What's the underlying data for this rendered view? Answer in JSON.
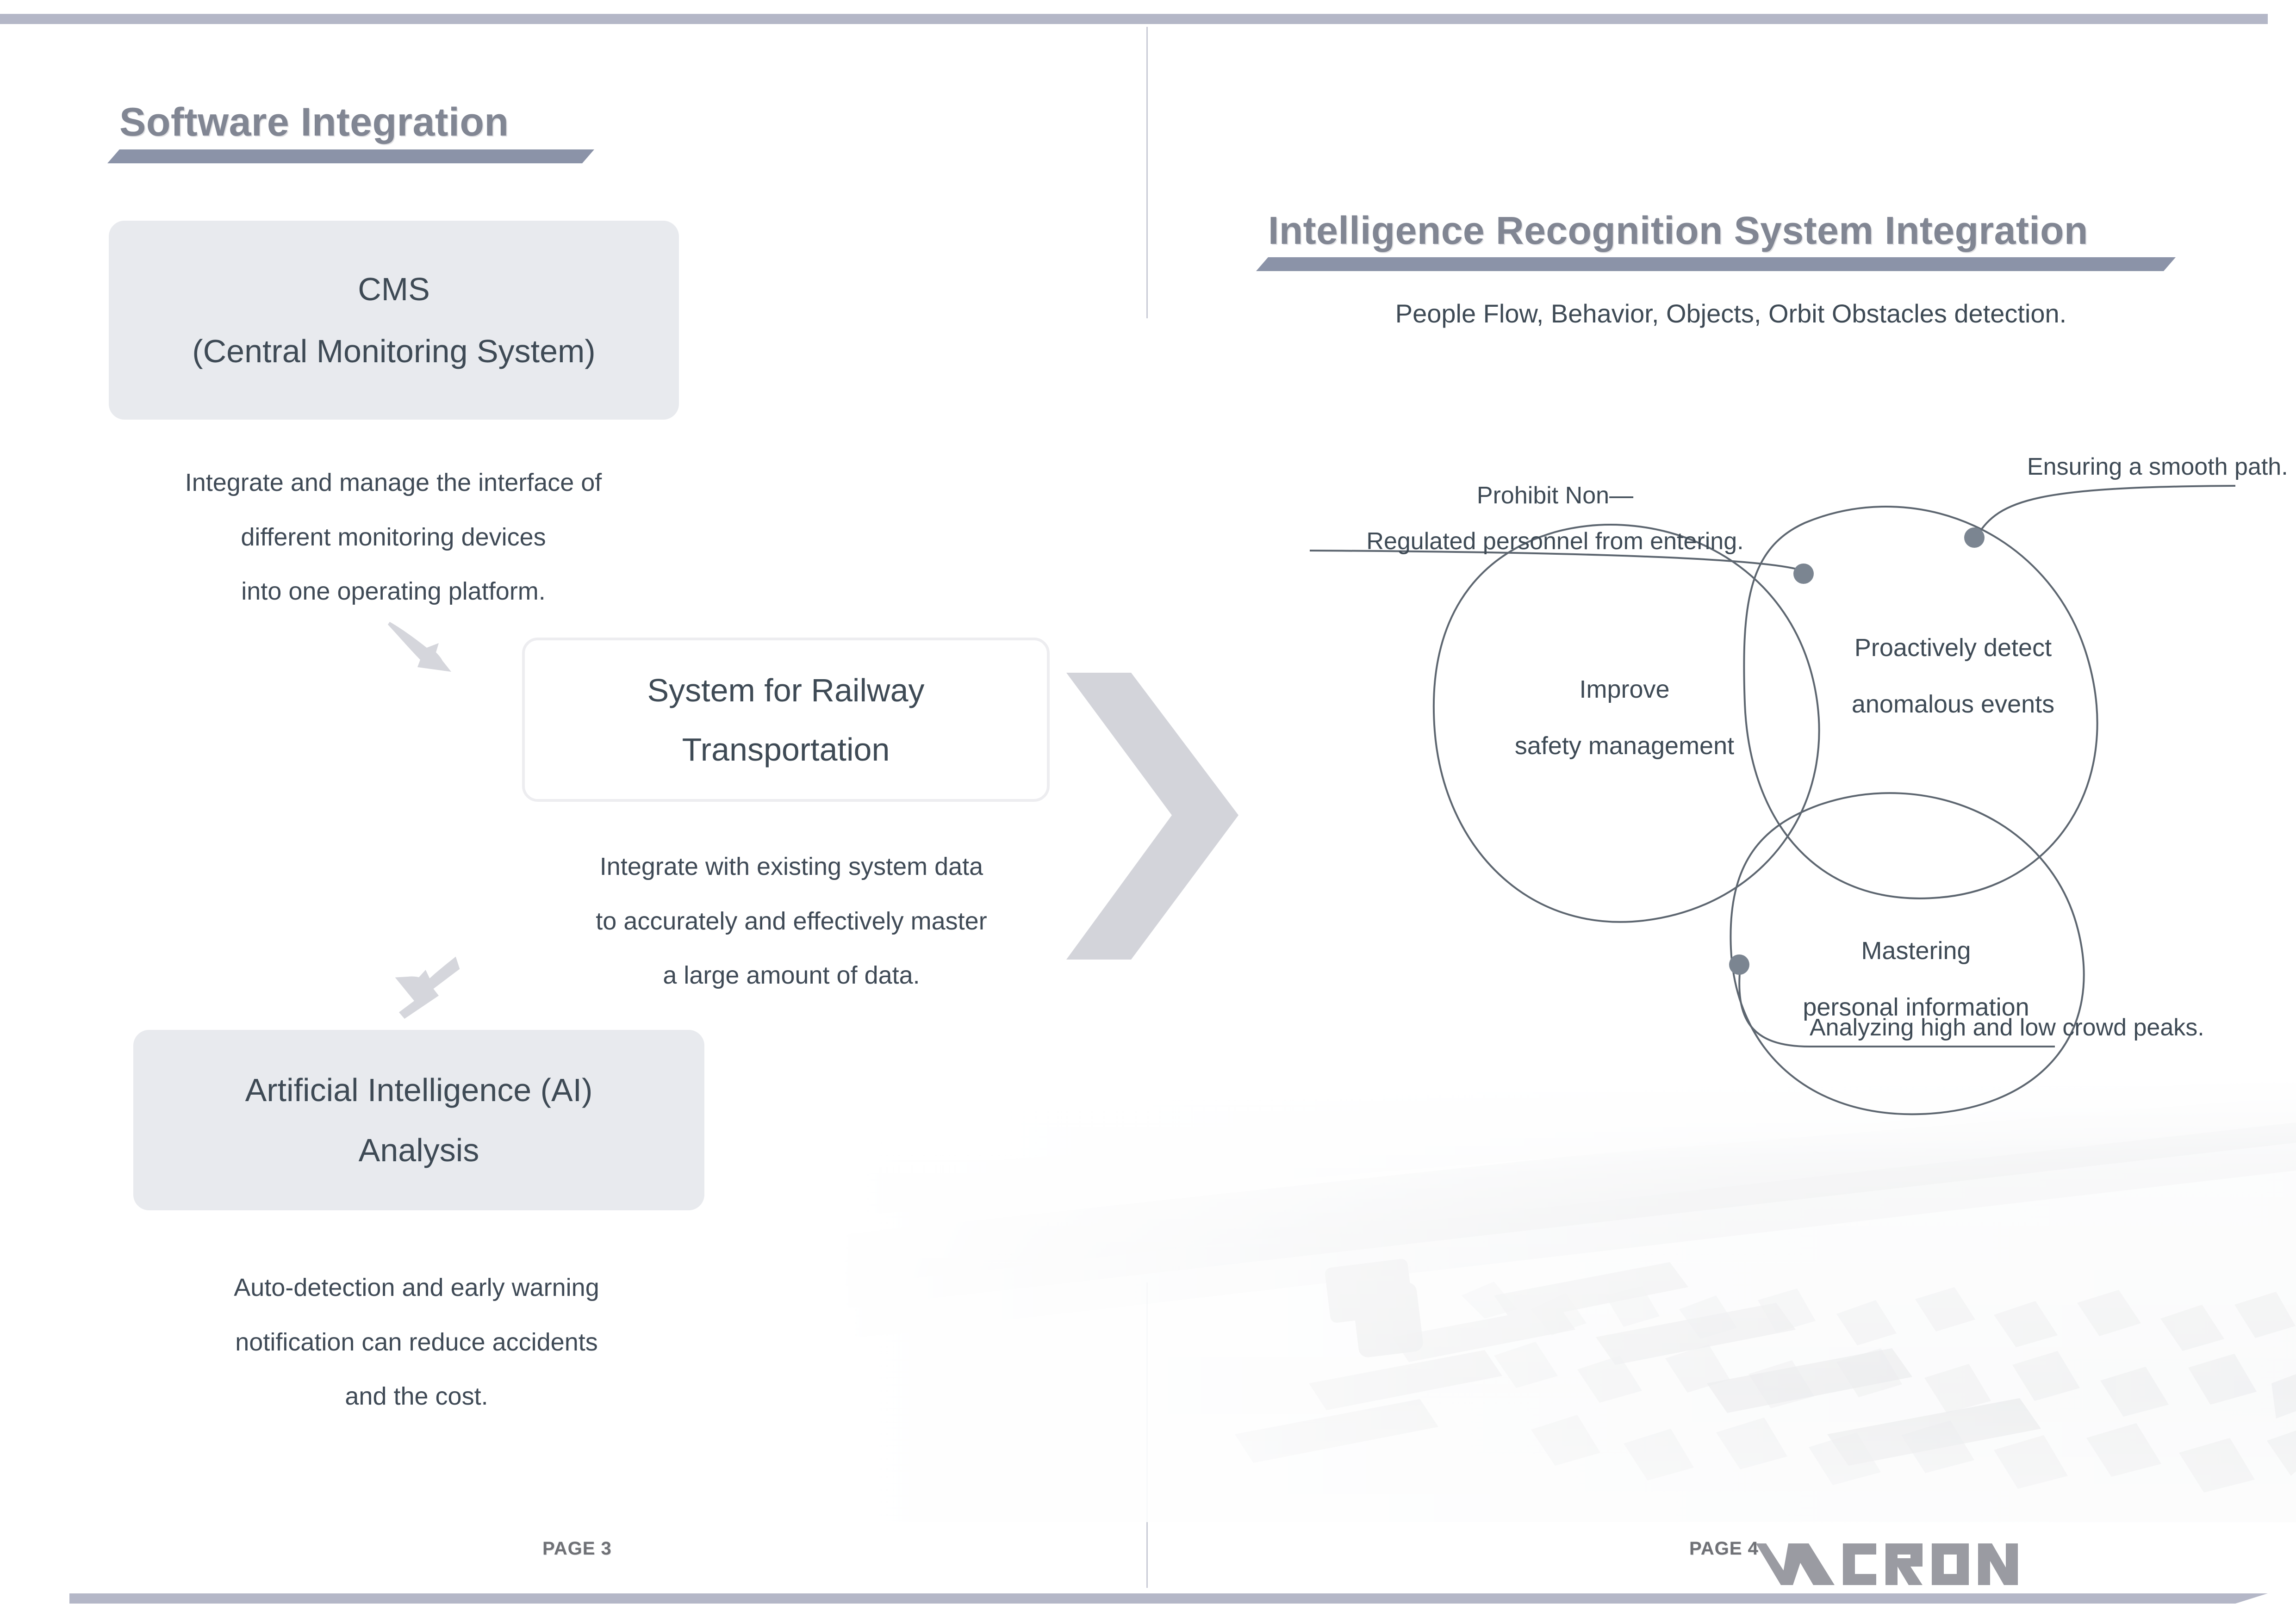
{
  "left_panel": {
    "title": "Software Integration",
    "cms_box": {
      "line1": "CMS",
      "line2": "(Central Monitoring System)"
    },
    "cms_description": {
      "line1": "Integrate and manage the interface of",
      "line2": "different monitoring devices",
      "line3": "into one operating platform."
    },
    "railway_box": {
      "line1": "System for Railway",
      "line2": "Transportation"
    },
    "railway_description": {
      "line1": "Integrate with existing system data",
      "line2": "to accurately and effectively master",
      "line3": "a large amount of data."
    },
    "ai_box": {
      "line1": "Artificial Intelligence (AI)",
      "line2": "Analysis"
    },
    "ai_description": {
      "line1": "Auto-detection and early warning",
      "line2": "notification can reduce accidents",
      "line3": "and the cost."
    },
    "page_number": "PAGE 3"
  },
  "right_panel": {
    "title": "Intelligence Recognition System Integration",
    "subtitle": "People Flow, Behavior, Objects, Orbit Obstacles detection.",
    "ellipses": [
      {
        "name": "improve-safety",
        "line1": "Improve",
        "line2": "safety management"
      },
      {
        "name": "proactive-detect",
        "line1": "Proactively detect",
        "line2": "anomalous events"
      },
      {
        "name": "mastering-personal-info",
        "line1": "Mastering",
        "line2": "personal information"
      }
    ],
    "callouts": [
      {
        "name": "prohibit-non-regulated",
        "line1": "Prohibit Non—",
        "line2": "Regulated personnel from entering."
      },
      {
        "name": "ensuring-smooth-path",
        "line1": "Ensuring a smooth path.",
        "line2": ""
      },
      {
        "name": "analyzing-crowd-peaks",
        "line1": "Analyzing high and low crowd peaks.",
        "line2": ""
      }
    ],
    "page_number": "PAGE 4",
    "brand": "VACRON"
  },
  "colors": {
    "bar": "#b4b7c7",
    "title_text": "#818693",
    "title_underline": "#8b93a8",
    "box_fill": "#e8eaee",
    "body_text": "#3e4a55",
    "arrow_fill": "#d3d4da",
    "ellipse_stroke": "#5d6670",
    "dot": "#7b8591"
  }
}
